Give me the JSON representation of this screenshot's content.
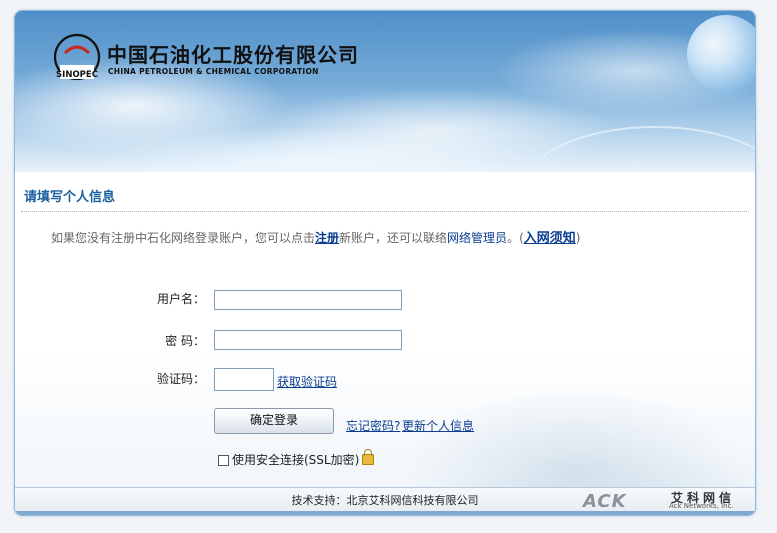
{
  "header": {
    "company_cn": "中国石油化工股份有限公司",
    "company_en": "CHINA PETROLEUM & CHEMICAL CORPORATION",
    "logo_mark_text": "SINOPEC"
  },
  "form": {
    "section_title": "请填写个人信息",
    "notice": {
      "part1": "如果您没有注册中石化网络登录账户，您可以点击",
      "register_link": "注册",
      "part2": "新账户，还可以联络",
      "admin_text": "网络管理员",
      "part3": "。(",
      "notice_link": "入网须知",
      "part4": ")"
    },
    "username_label": "用户名：",
    "username_value": "",
    "password_label": "密  码：",
    "password_value": "",
    "captcha_label": "验证码：",
    "captcha_value": "",
    "get_captcha_link": "获取验证码",
    "login_button": "确定登录",
    "forgot_password_link": "忘记密码?",
    "update_info_link": "更新个人信息",
    "ssl_label": "使用安全连接(SSL加密)",
    "ssl_checked": false
  },
  "footer": {
    "support_text": "技术支持：北京艾科网信科技有限公司",
    "vendor_mark": "ACK",
    "vendor_cn": "艾科网信",
    "vendor_en": "Ack Networks, Inc."
  },
  "colors": {
    "title_blue": "#1a5f9e",
    "link_blue": "#0b3d91",
    "frame_border": "#8fb7d9"
  }
}
